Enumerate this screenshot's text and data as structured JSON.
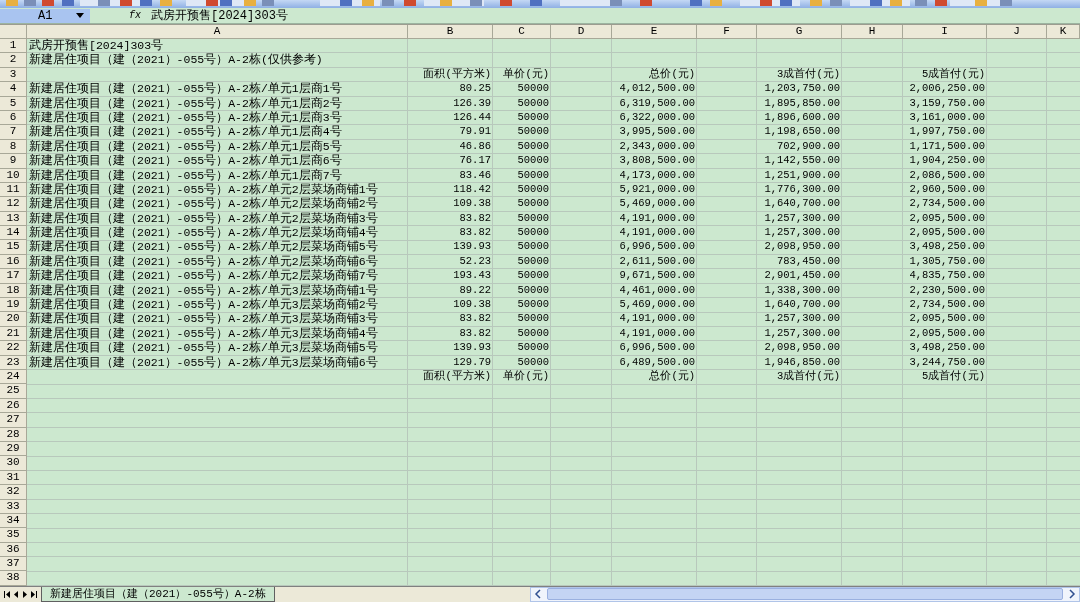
{
  "name_box": {
    "value": "A1"
  },
  "formula_bar": {
    "fx": "fx",
    "value": "武房开预售[2024]303号"
  },
  "columns": [
    "A",
    "B",
    "C",
    "D",
    "E",
    "F",
    "G",
    "H",
    "I",
    "J",
    "K"
  ],
  "rows": [
    {
      "number": "1",
      "A": "武房开预售[2024]303号"
    },
    {
      "number": "2",
      "A": "新建居住项目（建（2021）-055号）A-2栋(仅供参考)"
    },
    {
      "number": "3",
      "B": "面积(平方米)",
      "C": "单价(元)",
      "E": "总价(元)",
      "G": "3成首付(元)",
      "I": "5成首付(元)"
    },
    {
      "number": "4",
      "A": "新建居住项目（建（2021）-055号）A-2栋/单元1层商1号",
      "B": "80.25",
      "C": "50000",
      "E": "4,012,500.00",
      "G": "1,203,750.00",
      "I": "2,006,250.00"
    },
    {
      "number": "5",
      "A": "新建居住项目（建（2021）-055号）A-2栋/单元1层商2号",
      "B": "126.39",
      "C": "50000",
      "E": "6,319,500.00",
      "G": "1,895,850.00",
      "I": "3,159,750.00"
    },
    {
      "number": "6",
      "A": "新建居住项目（建（2021）-055号）A-2栋/单元1层商3号",
      "B": "126.44",
      "C": "50000",
      "E": "6,322,000.00",
      "G": "1,896,600.00",
      "I": "3,161,000.00"
    },
    {
      "number": "7",
      "A": "新建居住项目（建（2021）-055号）A-2栋/单元1层商4号",
      "B": "79.91",
      "C": "50000",
      "E": "3,995,500.00",
      "G": "1,198,650.00",
      "I": "1,997,750.00"
    },
    {
      "number": "8",
      "A": "新建居住项目（建（2021）-055号）A-2栋/单元1层商5号",
      "B": "46.86",
      "C": "50000",
      "E": "2,343,000.00",
      "G": "702,900.00",
      "I": "1,171,500.00"
    },
    {
      "number": "9",
      "A": "新建居住项目（建（2021）-055号）A-2栋/单元1层商6号",
      "B": "76.17",
      "C": "50000",
      "E": "3,808,500.00",
      "G": "1,142,550.00",
      "I": "1,904,250.00"
    },
    {
      "number": "10",
      "A": "新建居住项目（建（2021）-055号）A-2栋/单元1层商7号",
      "B": "83.46",
      "C": "50000",
      "E": "4,173,000.00",
      "G": "1,251,900.00",
      "I": "2,086,500.00"
    },
    {
      "number": "11",
      "A": "新建居住项目（建（2021）-055号）A-2栋/单元2层菜场商铺1号",
      "B": "118.42",
      "C": "50000",
      "E": "5,921,000.00",
      "G": "1,776,300.00",
      "I": "2,960,500.00"
    },
    {
      "number": "12",
      "A": "新建居住项目（建（2021）-055号）A-2栋/单元2层菜场商铺2号",
      "B": "109.38",
      "C": "50000",
      "E": "5,469,000.00",
      "G": "1,640,700.00",
      "I": "2,734,500.00"
    },
    {
      "number": "13",
      "A": "新建居住项目（建（2021）-055号）A-2栋/单元2层菜场商铺3号",
      "B": "83.82",
      "C": "50000",
      "E": "4,191,000.00",
      "G": "1,257,300.00",
      "I": "2,095,500.00"
    },
    {
      "number": "14",
      "A": "新建居住项目（建（2021）-055号）A-2栋/单元2层菜场商铺4号",
      "B": "83.82",
      "C": "50000",
      "E": "4,191,000.00",
      "G": "1,257,300.00",
      "I": "2,095,500.00"
    },
    {
      "number": "15",
      "A": "新建居住项目（建（2021）-055号）A-2栋/单元2层菜场商铺5号",
      "B": "139.93",
      "C": "50000",
      "E": "6,996,500.00",
      "G": "2,098,950.00",
      "I": "3,498,250.00"
    },
    {
      "number": "16",
      "A": "新建居住项目（建（2021）-055号）A-2栋/单元2层菜场商铺6号",
      "B": "52.23",
      "C": "50000",
      "E": "2,611,500.00",
      "G": "783,450.00",
      "I": "1,305,750.00"
    },
    {
      "number": "17",
      "A": "新建居住项目（建（2021）-055号）A-2栋/单元2层菜场商铺7号",
      "B": "193.43",
      "C": "50000",
      "E": "9,671,500.00",
      "G": "2,901,450.00",
      "I": "4,835,750.00"
    },
    {
      "number": "18",
      "A": "新建居住项目（建（2021）-055号）A-2栋/单元3层菜场商铺1号",
      "B": "89.22",
      "C": "50000",
      "E": "4,461,000.00",
      "G": "1,338,300.00",
      "I": "2,230,500.00"
    },
    {
      "number": "19",
      "A": "新建居住项目（建（2021）-055号）A-2栋/单元3层菜场商铺2号",
      "B": "109.38",
      "C": "50000",
      "E": "5,469,000.00",
      "G": "1,640,700.00",
      "I": "2,734,500.00"
    },
    {
      "number": "20",
      "A": "新建居住项目（建（2021）-055号）A-2栋/单元3层菜场商铺3号",
      "B": "83.82",
      "C": "50000",
      "E": "4,191,000.00",
      "G": "1,257,300.00",
      "I": "2,095,500.00"
    },
    {
      "number": "21",
      "A": "新建居住项目（建（2021）-055号）A-2栋/单元3层菜场商铺4号",
      "B": "83.82",
      "C": "50000",
      "E": "4,191,000.00",
      "G": "1,257,300.00",
      "I": "2,095,500.00"
    },
    {
      "number": "22",
      "A": "新建居住项目（建（2021）-055号）A-2栋/单元3层菜场商铺5号",
      "B": "139.93",
      "C": "50000",
      "E": "6,996,500.00",
      "G": "2,098,950.00",
      "I": "3,498,250.00"
    },
    {
      "number": "23",
      "A": "新建居住项目（建（2021）-055号）A-2栋/单元3层菜场商铺6号",
      "B": "129.79",
      "C": "50000",
      "E": "6,489,500.00",
      "G": "1,946,850.00",
      "I": "3,244,750.00"
    },
    {
      "number": "24",
      "B": "面积(平方米)",
      "C": "单价(元)",
      "E": "总价(元)",
      "G": "3成首付(元)",
      "I": "5成首付(元)"
    },
    {
      "number": "25"
    },
    {
      "number": "26"
    },
    {
      "number": "27"
    },
    {
      "number": "28"
    },
    {
      "number": "29"
    },
    {
      "number": "30"
    },
    {
      "number": "31"
    },
    {
      "number": "32"
    },
    {
      "number": "33"
    },
    {
      "number": "34"
    },
    {
      "number": "35"
    },
    {
      "number": "36"
    },
    {
      "number": "37"
    },
    {
      "number": "38"
    }
  ],
  "sheet_tabs": [
    {
      "label": "新建居住项目（建（2021）-055号）A-2栋",
      "selected": true
    }
  ]
}
